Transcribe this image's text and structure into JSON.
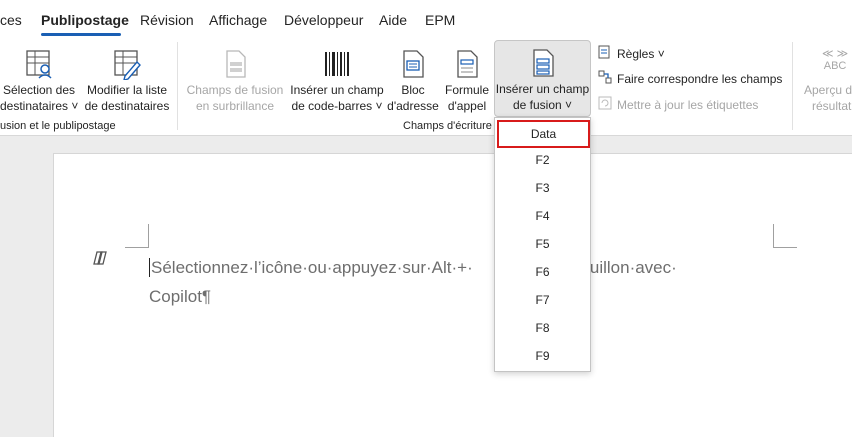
{
  "tabs": [
    {
      "label": "ces",
      "active": false
    },
    {
      "label": "Publipostage",
      "active": true
    },
    {
      "label": "Révision",
      "active": false
    },
    {
      "label": "Affichage",
      "active": false
    },
    {
      "label": "Développeur",
      "active": false
    },
    {
      "label": "Aide",
      "active": false
    },
    {
      "label": "EPM",
      "active": false
    }
  ],
  "ribbon": {
    "select_recipients": {
      "line1": "Sélection des",
      "line2": "destinataires ˅"
    },
    "edit_list": {
      "line1": "Modifier la liste",
      "line2": "de destinataires"
    },
    "group_start_label": "usion et le publipostage",
    "highlight_fields": {
      "line1": "Champs de fusion",
      "line2": "en surbrillance"
    },
    "insert_barcode": {
      "line1": "Insérer un champ",
      "line2": "de code-barres ˅"
    },
    "address_block": {
      "line1": "Bloc",
      "line2": "d'adresse"
    },
    "greeting_line": {
      "line1": "Formule",
      "line2": "d'appel"
    },
    "insert_merge_field": {
      "line1": "Insérer un champ",
      "line2": "de fusion ˅"
    },
    "group_write_label": "Champs d'écriture",
    "rules": "Règles ˅",
    "match_fields": "Faire correspondre les champs",
    "update_labels": "Mettre à jour les étiquettes",
    "preview_abc": "ABC",
    "preview_results": {
      "line1": "Aperçu d",
      "line2": "résultat"
    }
  },
  "dropdown": {
    "items": [
      "Data",
      "F2",
      "F3",
      "F4",
      "F5",
      "F6",
      "F7",
      "F8",
      "F9"
    ],
    "highlighted": "Data"
  },
  "document": {
    "prompt_text": "Sélectionnez·l’icône·ou·appuyez·sur·Alt·+·",
    "prompt_hidden_tail": "un·brouillon·avec·",
    "line2": "Copilot¶"
  },
  "colors": {
    "accent": "#1a5fb4",
    "highlight_border": "#d81b1b"
  }
}
